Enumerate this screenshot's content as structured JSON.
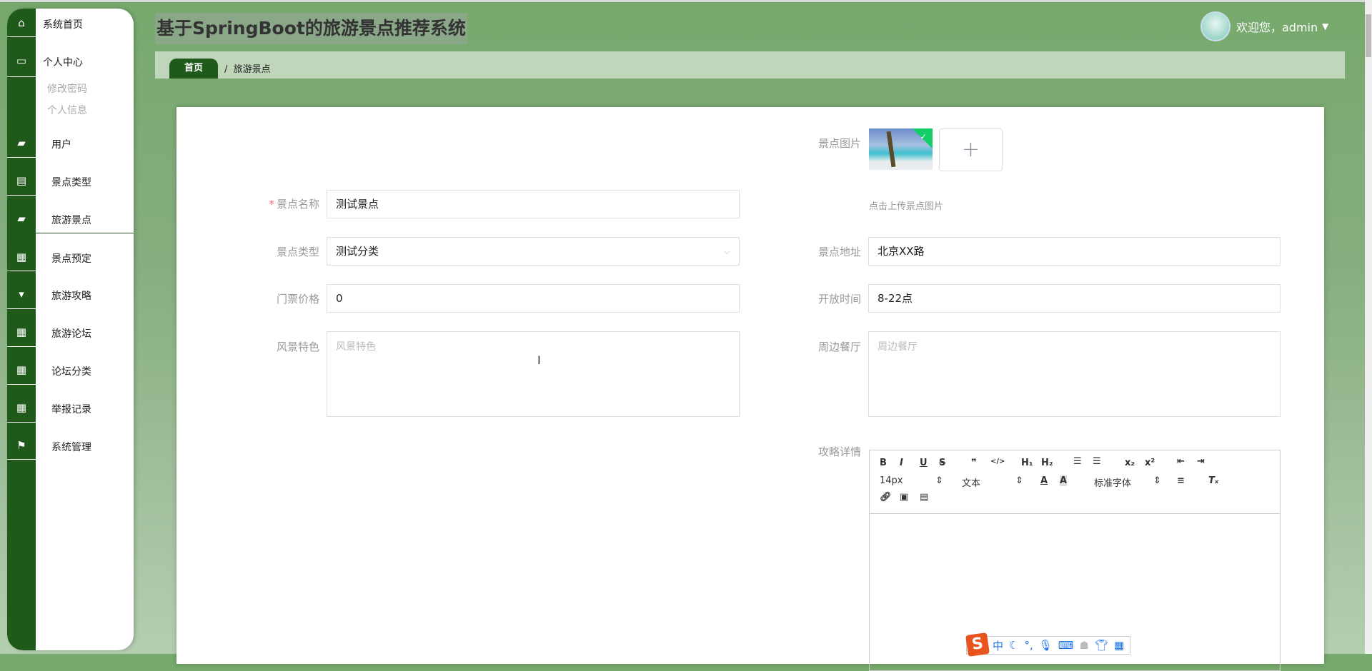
{
  "header": {
    "title": "基于SpringBoot的旅游景点推荐系统",
    "welcome": "欢迎您，admin",
    "caret": "▼"
  },
  "breadcrumb": {
    "home": "首页",
    "separator": "/",
    "current": "旅游景点"
  },
  "sidebar": {
    "home": "系统首页",
    "personal": "个人中心",
    "sub": [
      "修改密码",
      "个人信息"
    ],
    "items": [
      "用户",
      "景点类型",
      "旅游景点",
      "景点预定",
      "旅游攻略",
      "旅游论坛",
      "论坛分类",
      "举报记录",
      "系统管理"
    ]
  },
  "form": {
    "name_label": "景点名称",
    "name_value": "测试景点",
    "required_mark": "*",
    "type_label": "景点类型",
    "type_value": "测试分类",
    "price_label": "门票价格",
    "price_value": "0",
    "scenery_label": "风景特色",
    "scenery_placeholder": "风景特色",
    "image_label": "景点图片",
    "upload_hint": "点击上传景点图片",
    "plus": "+",
    "address_label": "景点地址",
    "address_value": "北京XX路",
    "hours_label": "开放时间",
    "hours_value": "8-22点",
    "food_label": "周边餐厅",
    "food_placeholder": "周边餐厅",
    "detail_label": "攻略详情"
  },
  "editor": {
    "size": "14px",
    "header": "文本",
    "font": "标准字体"
  },
  "ime": {
    "logo": "S",
    "mode": "中"
  }
}
